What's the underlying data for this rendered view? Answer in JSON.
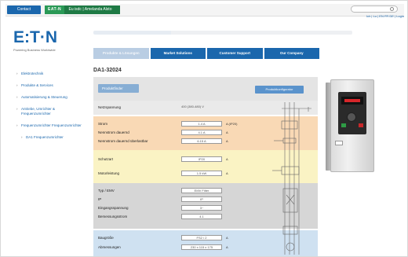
{
  "topbar": {
    "contact_label": "Contact",
    "brand_logo": "EAT-N",
    "brand_sub": "Eu isdc | Amelanda Alsto",
    "search_placeholder": "Search",
    "toplinks": "Ich | Lo | EN FR DE | Login"
  },
  "logo": {
    "text": "E:T·N",
    "tagline": "Powering Business Worldwide"
  },
  "nav_tabs": [
    {
      "label": "Produkte & Lösungen",
      "active": true
    },
    {
      "label": "Market Solutions"
    },
    {
      "label": "Customer Support"
    },
    {
      "label": "Our Company"
    }
  ],
  "left_nav": [
    {
      "label": "Elektrotechnik"
    },
    {
      "label": "Produkte & Services"
    },
    {
      "label": "Automatisierung & Steuerung"
    },
    {
      "label": "Antriebe, Umrichter & Frequenzumrichter"
    },
    {
      "label": "Frequenzumrichter Frequenzumrichter"
    },
    {
      "label": "DA1 Frequenzumrichter"
    }
  ],
  "main": {
    "product_title": "DA1-32024",
    "head_left_btn": "Produktfinder",
    "head_right_btn": "Produktkonfigurator",
    "voltage": {
      "label": "Netzspannung",
      "value": "400 (380-480) V"
    },
    "orange_rows": [
      {
        "label": "Strom",
        "value": "1.4 A",
        "unit": "A (IP20)"
      },
      {
        "label": "Nennstrom dauernd",
        "value": "4.1 A",
        "unit": "A"
      },
      {
        "label": "Nennstrom dauernd überlastbar",
        "value": "6.15 A",
        "unit": "A"
      }
    ],
    "yellow_rows": [
      {
        "label": "Schutzart",
        "value": "IP20",
        "unit": "A"
      },
      {
        "label": "Motorleistung",
        "value": "1.5 kW",
        "unit": "A"
      }
    ],
    "gray_rows": [
      {
        "label": "Typ / EMV",
        "value": "EMV Filter",
        "unit": ""
      },
      {
        "label": "IP",
        "value": "IP",
        "unit": ""
      },
      {
        "label": "Eingangsspannung",
        "value": "3~",
        "unit": ""
      },
      {
        "label": "Bemessungsstrom",
        "value": "4.1",
        "unit": ""
      }
    ],
    "blue_rows": [
      {
        "label": "Baugröße",
        "value": "FS2 / 2",
        "unit": "A"
      },
      {
        "label": "Abmessungen",
        "value": "230 x 115 x 175",
        "unit": "A"
      }
    ]
  }
}
